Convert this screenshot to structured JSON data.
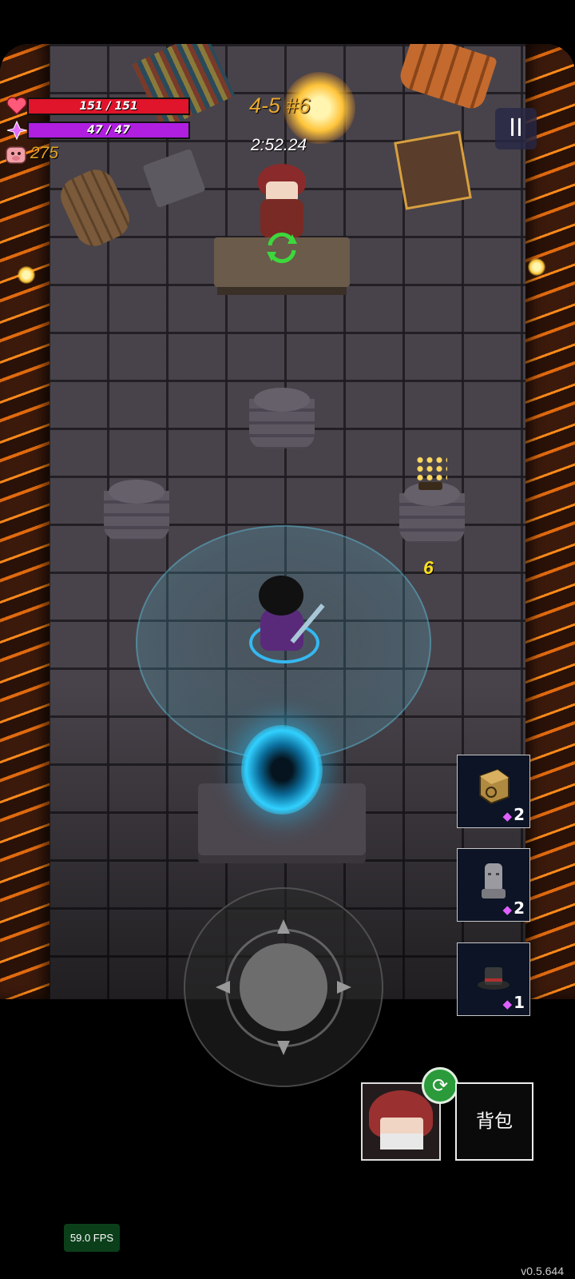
{
  "hud": {
    "health_text": "151 / 151",
    "health_fraction": 1.0,
    "mana_text": "47 / 47",
    "mana_fraction": 1.0,
    "coins": "275",
    "level_label": "4-5 #6",
    "timer": "2:52.24",
    "damage_popup": "6",
    "icons": {
      "health": "heart-icon",
      "mana": "mana-gem-icon",
      "coins": "pig-coin-icon",
      "pause": "pause-icon"
    },
    "colors": {
      "health": "#e0142a",
      "mana": "#b01ee0",
      "coins": "#e0a424"
    }
  },
  "skills": [
    {
      "icon": "rune-cube-icon",
      "cost": "2"
    },
    {
      "icon": "stone-head-icon",
      "cost": "2"
    },
    {
      "icon": "top-hat-icon",
      "cost": "1"
    }
  ],
  "controls": {
    "bag_label": "背包",
    "character_icon": "character-portrait-icon",
    "swap_icon": "swap-cycle-icon"
  },
  "footer": {
    "fps": "59.0 FPS",
    "version": "v0.5.644"
  }
}
